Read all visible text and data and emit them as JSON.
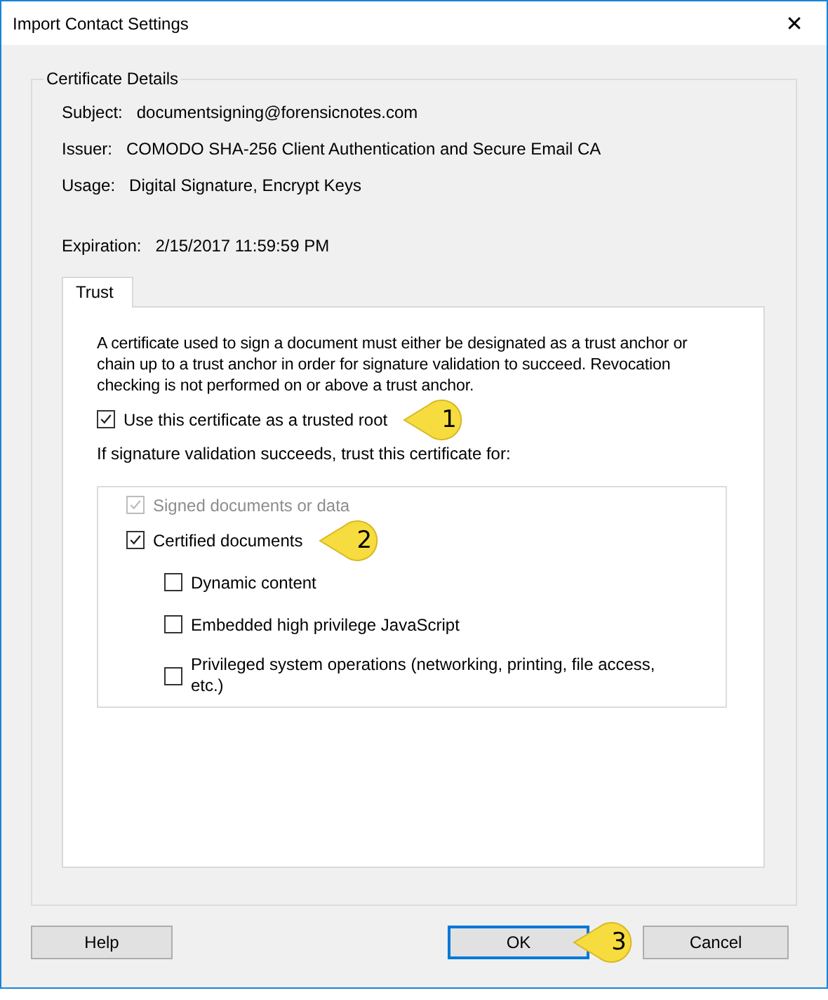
{
  "window": {
    "title": "Import Contact Settings",
    "close": "✕"
  },
  "certificate_details": {
    "title": "Certificate Details",
    "fields": [
      {
        "label": "Subject:",
        "value": "documentsigning@forensicnotes.com"
      },
      {
        "label": "Issuer:",
        "value": "COMODO SHA-256 Client Authentication and Secure Email CA"
      },
      {
        "label": "Usage:",
        "value": "Digital Signature, Encrypt Keys"
      }
    ],
    "expiration": {
      "label": "Expiration:",
      "value": "2/15/2017 11:59:59 PM"
    }
  },
  "tabs": [
    {
      "label": "Trust",
      "selected": true
    }
  ],
  "trust": {
    "description": "A certificate used to sign a document must either be designated as a trust anchor or chain up to a trust anchor in order for signature validation to succeed.  Revocation checking is not performed on or above a trust anchor.",
    "trusted_root": {
      "label": "Use this certificate as a trusted root",
      "checked": true,
      "disabled": false,
      "callout": "1"
    },
    "trust_for_label": "If signature validation succeeds, trust this certificate for:",
    "trust_for": [
      {
        "label": "Signed documents or data",
        "checked": true,
        "disabled": true
      },
      {
        "label": "Certified documents",
        "checked": true,
        "disabled": false,
        "callout": "2",
        "children": [
          {
            "label": "Dynamic content",
            "checked": false,
            "disabled": false
          },
          {
            "label": "Embedded high privilege JavaScript",
            "checked": false,
            "disabled": false
          },
          {
            "label": "Privileged system operations (networking, printing, file access, etc.)",
            "checked": false,
            "disabled": false
          }
        ]
      }
    ]
  },
  "buttons": [
    {
      "label": "Help",
      "default": false
    },
    {
      "label": "OK",
      "default": true,
      "callout": "3"
    },
    {
      "label": "Cancel",
      "default": false
    }
  ]
}
